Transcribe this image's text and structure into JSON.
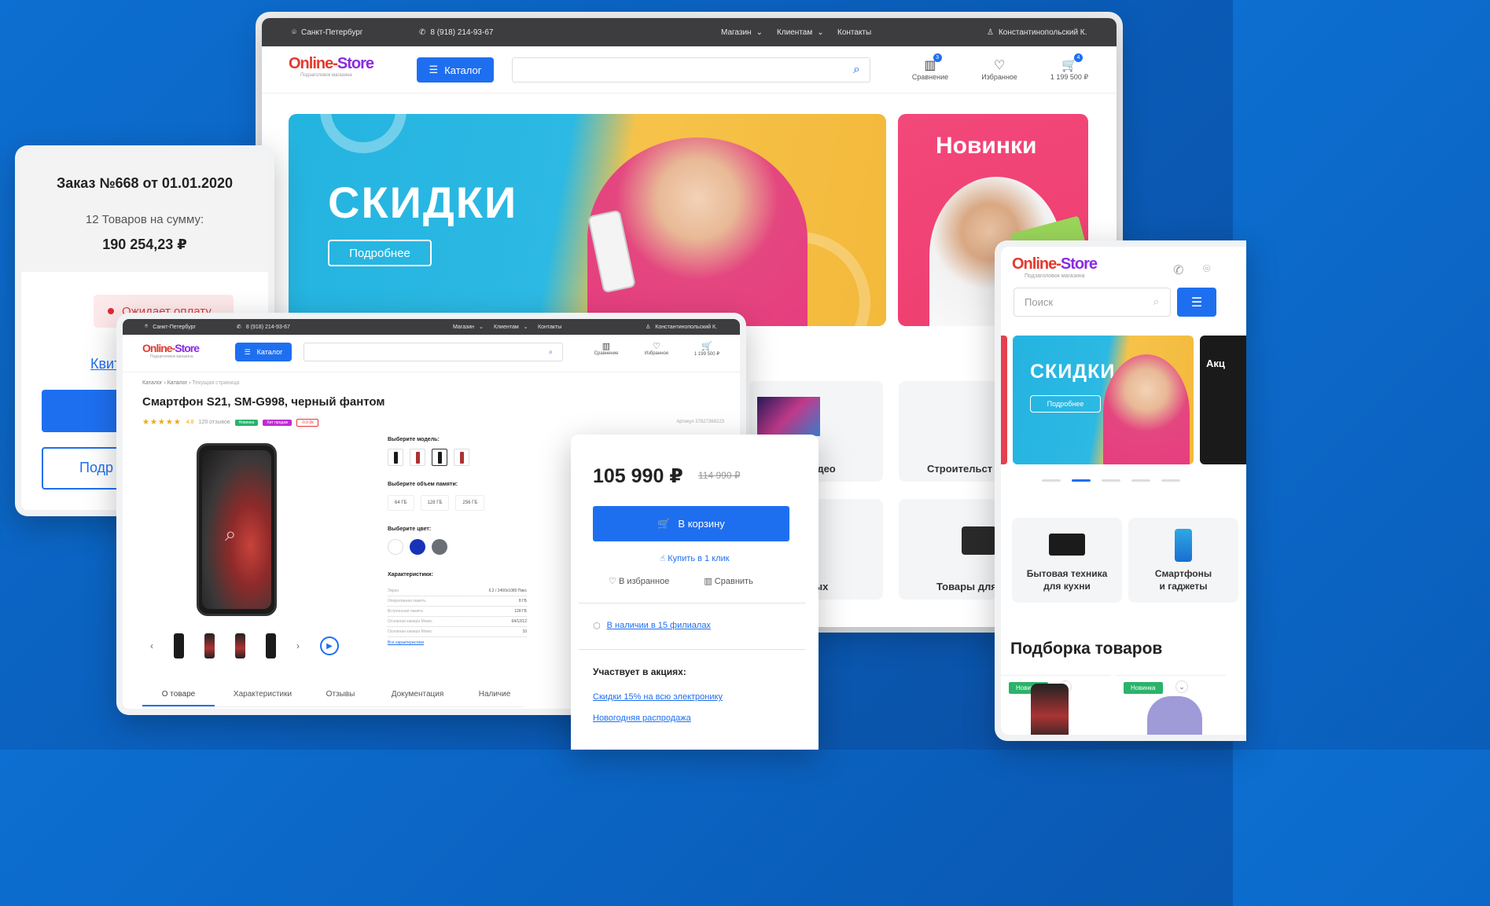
{
  "colors": {
    "accent": "#1e6ff0",
    "background": "#0d6fd1",
    "status_red": "#e02a33",
    "new_green": "#2ab36a"
  },
  "topbar": {
    "city": "Санкт-Петербург",
    "phone": "8 (918) 214-93-67",
    "nav": [
      "Магазин",
      "Клиентам",
      "Контакты"
    ],
    "user": "Константинопольский К."
  },
  "logo": {
    "name_on": "Online-",
    "name_store": "Store",
    "tagline": "Подзаголовок магазина"
  },
  "header": {
    "catalog": "Каталог",
    "compare": "Сравнение",
    "favorites": "Избранное",
    "cart_total": "1 199 500 ₽",
    "compare_count": "3",
    "cart_count": "4"
  },
  "banners": {
    "sale": "СКИДКИ",
    "sale_button": "Подробнее",
    "new": "Новинки"
  },
  "categories_desktop": [
    "-видео",
    "Строительст",
    "ых",
    "Товары для "
  ],
  "order": {
    "title": "Заказ №668 от 01.01.2020",
    "items": "12 Товаров на сумму:",
    "sum": "190 254,23 ₽",
    "status": "Ожидает оплату",
    "link_partial": "Квит",
    "button_partial": "Подр"
  },
  "product": {
    "breadcrumbs": [
      "Каталог",
      "Каталог",
      "Текущая страница"
    ],
    "title": "Смартфон  S21, SM-G998, черный фантом",
    "rating": "4.8",
    "reviews": "120 отзывов",
    "tags": [
      "Новинка",
      "Хит продаж",
      "-0.0-2k"
    ],
    "sku": "Артикул 37827368223",
    "choose_model": "Выберите модель:",
    "choose_memory": "Выберите объем памяти:",
    "memory_options": [
      "64 ГБ",
      "128 ГБ",
      "256 ГБ"
    ],
    "choose_color": "Выберите цвет:",
    "specs_title": "Характеристики:",
    "specs": [
      {
        "k": "Экран",
        "v": "6.2 / 2400х1080 Пикс"
      },
      {
        "k": "Оперативная память",
        "v": "8 ГБ"
      },
      {
        "k": "Встроенная память",
        "v": "128 ГБ"
      },
      {
        "k": "Основная камера Мпикс",
        "v": "64/12/12"
      },
      {
        "k": "Основная камера Мпикс",
        "v": "10"
      }
    ],
    "all_specs": "Все характеристики",
    "tabs": [
      "О товаре",
      "Характеристики",
      "Отзывы",
      "Документация",
      "Наличие"
    ]
  },
  "buy": {
    "price": "105 990 ₽",
    "old_price": "114 990 ₽",
    "cart_button": "В корзину",
    "one_click": "Купить в 1 клик",
    "favorite": "В избранное",
    "compare": "Сравнить",
    "stock": "В наличии в 15 филиалах",
    "promo_title": "Участвует в акциях:",
    "promos": [
      "Скидки 15% на всю электронику",
      "Новогодняя распродажа"
    ]
  },
  "mobile": {
    "search_placeholder": "Поиск",
    "banner_sale": "СКИДКИ",
    "banner_button": "Подробнее",
    "banner_partial": "Акц",
    "tile1": "Бытовая техника\nдля кухни",
    "tile2": "Смартфоны\nи гаджеты",
    "section_title": "Подборка товаров",
    "new_tag": "Новинка"
  }
}
